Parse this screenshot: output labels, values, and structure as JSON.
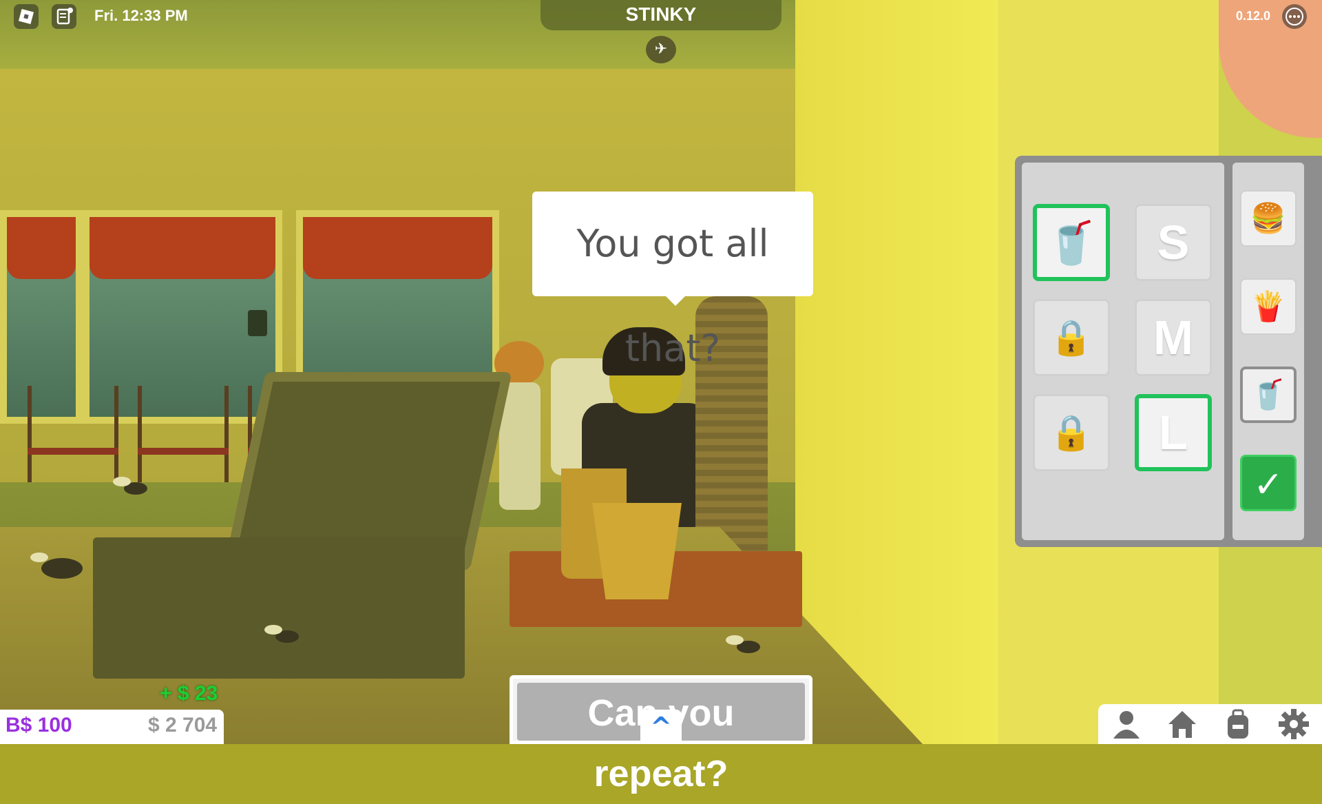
{
  "hud": {
    "clock": "Fri. 12:33 PM",
    "version": "0.12.0",
    "title": "STINKY",
    "icons": [
      "roblox-logo-icon",
      "notes-icon",
      "fly-icon",
      "menu-dots-icon"
    ]
  },
  "dialog": {
    "text": "You got all that?"
  },
  "order_panel": {
    "sizes": [
      "S",
      "M",
      "L"
    ],
    "selected_size": "L",
    "tiles": [
      {
        "kind": "drink",
        "selected": true
      },
      {
        "kind": "locked-side",
        "selected": false
      },
      {
        "kind": "locked-toy",
        "selected": false
      }
    ],
    "summary_icons": [
      "burger-icon",
      "fries-icon",
      "drink-icon"
    ],
    "confirm_icon": "checkmark-icon"
  },
  "actions": {
    "repeat_label": "Can you repeat?",
    "expand_icon": "chevron-up-icon"
  },
  "currency": {
    "bucks": "B$ 100",
    "cash": "$ 2 704",
    "gain": "+ $ 23"
  },
  "nav": {
    "icons": [
      "avatar-icon",
      "home-icon",
      "backpack-icon",
      "settings-icon"
    ]
  }
}
